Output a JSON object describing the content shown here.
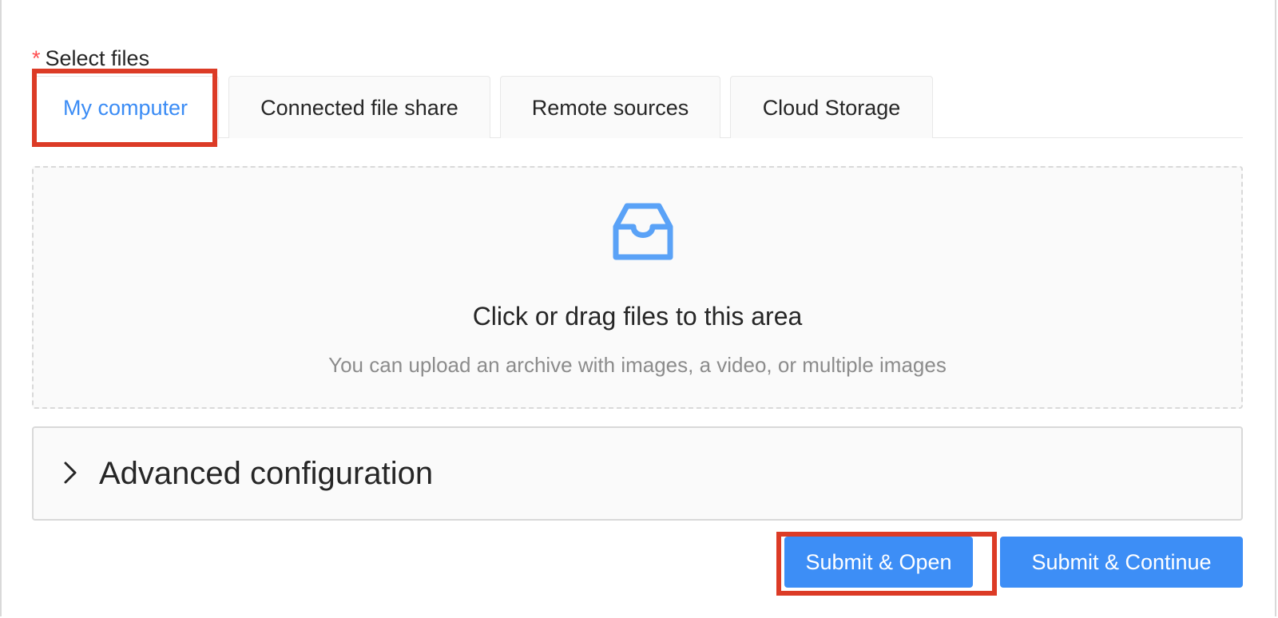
{
  "form": {
    "required_mark": "*",
    "select_files_label": "Select files"
  },
  "tabs": [
    {
      "label": "My computer",
      "active": true
    },
    {
      "label": "Connected file share",
      "active": false
    },
    {
      "label": "Remote sources",
      "active": false
    },
    {
      "label": "Cloud Storage",
      "active": false
    }
  ],
  "dropzone": {
    "icon": "inbox-icon",
    "text": "Click or drag files to this area",
    "hint": "You can upload an archive with images, a video, or multiple images"
  },
  "advanced": {
    "icon": "chevron-right-icon",
    "title": "Advanced configuration"
  },
  "actions": {
    "submit_open_label": "Submit & Open",
    "submit_continue_label": "Submit & Continue"
  },
  "colors": {
    "primary": "#3d8ef6",
    "active_tab_text": "#3b8cf5",
    "highlight": "#dc3b26",
    "required": "#ff4d4f"
  }
}
